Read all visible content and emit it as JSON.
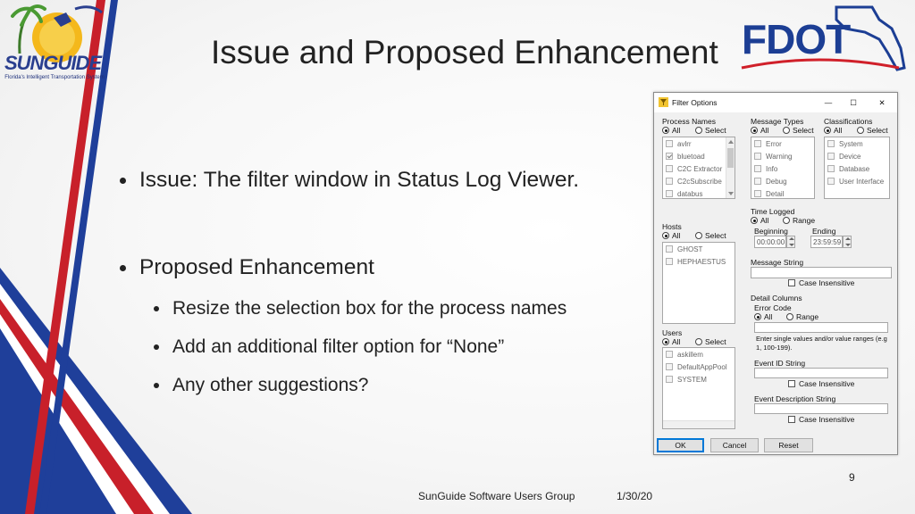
{
  "slide": {
    "title": "Issue and Proposed Enhancement",
    "bullets": [
      {
        "text": "Issue: The filter window in Status Log Viewer."
      },
      {
        "text": "Proposed Enhancement"
      }
    ],
    "sub_bullets": [
      {
        "text": "Resize the selection box for the process names"
      },
      {
        "text": "Add an additional filter option for “None”"
      },
      {
        "text": "Any other suggestions?"
      }
    ],
    "footer": {
      "group": "SunGuide Software Users Group",
      "date": "1/30/20",
      "page": "9"
    },
    "logos": {
      "sunguide_word": "SUNGUIDE",
      "sunguide_tagline": "Florida's Intelligent Transportation System",
      "fdot_word": "FDOT"
    },
    "colors": {
      "stripe_red": "#c8202a",
      "stripe_blue": "#1f3f9a",
      "fdot_blue": "#1c3e94",
      "fdot_red": "#d0202a"
    }
  },
  "dialog": {
    "title": "Filter Options",
    "window_buttons": {
      "minimize": "—",
      "maximize": "☐",
      "close": "✕"
    },
    "process_names": {
      "label": "Process Names",
      "all": "All",
      "select": "Select",
      "items": [
        {
          "label": "avlrr",
          "checked": false
        },
        {
          "label": "bluetoad",
          "checked": true
        },
        {
          "label": "C2C Extractor",
          "checked": false
        },
        {
          "label": "C2cSubscribe",
          "checked": false
        },
        {
          "label": "databus",
          "checked": false
        }
      ]
    },
    "message_types": {
      "label": "Message Types",
      "all": "All",
      "select": "Select",
      "items": [
        {
          "label": "Error"
        },
        {
          "label": "Warning"
        },
        {
          "label": "Info"
        },
        {
          "label": "Debug"
        },
        {
          "label": "Detail"
        }
      ]
    },
    "classifications": {
      "label": "Classifications",
      "all": "All",
      "select": "Select",
      "items": [
        {
          "label": "System"
        },
        {
          "label": "Device"
        },
        {
          "label": "Database"
        },
        {
          "label": "User Interface"
        }
      ]
    },
    "hosts": {
      "label": "Hosts",
      "all": "All",
      "select": "Select",
      "items": [
        {
          "label": "GHOST"
        },
        {
          "label": "HEPHAESTUS"
        }
      ]
    },
    "users": {
      "label": "Users",
      "all": "All",
      "select": "Select",
      "items": [
        {
          "label": "askillem"
        },
        {
          "label": "DefaultAppPool"
        },
        {
          "label": "SYSTEM"
        }
      ]
    },
    "time_logged": {
      "label": "Time Logged",
      "all": "All",
      "range": "Range",
      "beginning_label": "Beginning",
      "beginning_value": "00:00:00",
      "ending_label": "Ending",
      "ending_value": "23:59:59"
    },
    "message_string": {
      "label": "Message String",
      "value": "",
      "case_insensitive": "Case Insensitive"
    },
    "detail_columns": {
      "label": "Detail Columns",
      "error_code_label": "Error Code",
      "all": "All",
      "range": "Range",
      "error_code_value": "",
      "help": "Enter single values and/or value ranges (e.g 1, 100-199).",
      "event_id_label": "Event ID String",
      "event_id_value": "",
      "event_id_case": "Case Insensitive",
      "event_desc_label": "Event Description String",
      "event_desc_value": "",
      "event_desc_case": "Case Insensitive"
    },
    "buttons": {
      "ok": "OK",
      "cancel": "Cancel",
      "reset": "Reset"
    }
  }
}
